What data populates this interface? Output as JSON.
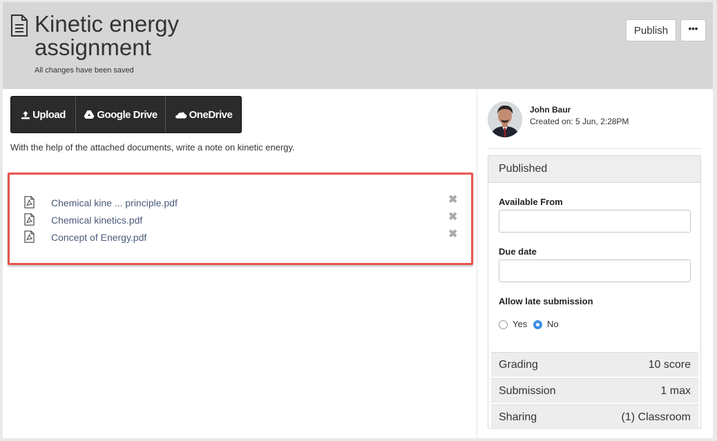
{
  "header": {
    "title": "Kinetic energy assignment",
    "save_status": "All changes have been saved",
    "publish_label": "Publish",
    "more_label": "•••"
  },
  "upload": {
    "buttons": [
      {
        "label": "Upload",
        "icon": "upload-icon"
      },
      {
        "label": "Google Drive",
        "icon": "google-drive-icon"
      },
      {
        "label": "OneDrive",
        "icon": "onedrive-icon"
      }
    ]
  },
  "instructions": "With the help of the attached documents, write a note on kinetic energy.",
  "attachments": [
    {
      "name": "Chemical kine ... principle.pdf"
    },
    {
      "name": "Chemical kinetics.pdf"
    },
    {
      "name": "Concept of Energy.pdf"
    }
  ],
  "remove_glyph": "✖",
  "author": {
    "name": "John Baur",
    "created": "Created on: 5 Jun, 2:28PM"
  },
  "panel": {
    "status": "Published",
    "available_from_label": "Available From",
    "due_date_label": "Due date",
    "late_label": "Allow late submission",
    "late_options": [
      "Yes",
      "No"
    ],
    "late_selected": "No",
    "rows": [
      {
        "key": "Grading",
        "value": "10 score"
      },
      {
        "key": "Submission",
        "value": "1 max"
      },
      {
        "key": "Sharing",
        "value": "(1) Classroom"
      }
    ]
  },
  "colors": {
    "header_bg": "#d6d6d6",
    "highlight_border": "#e8554e",
    "link": "#4a5a7a",
    "radio_selected": "#3b8ee6",
    "upload_bar": "#2b2b2b"
  }
}
